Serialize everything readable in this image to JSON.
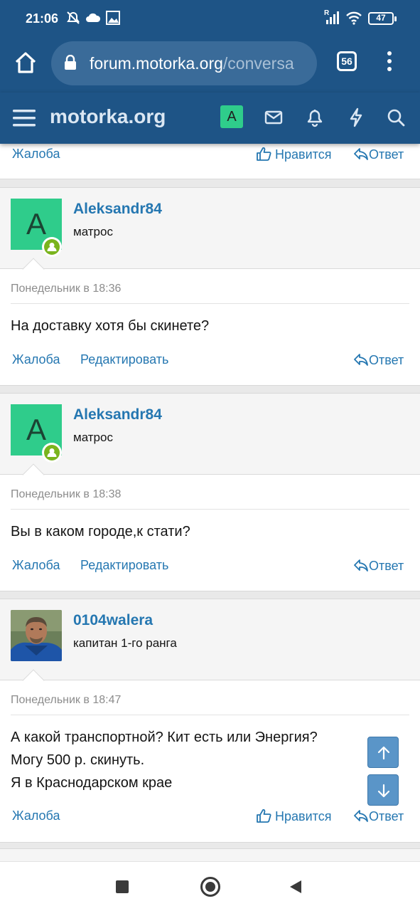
{
  "status_bar": {
    "time": "21:06",
    "signal_label": "R",
    "battery": "47",
    "icons": [
      "alarm-off-icon",
      "cloud-icon",
      "image-icon",
      "signal-icon",
      "wifi-icon",
      "battery-icon"
    ]
  },
  "browser": {
    "url_domain": "forum.motorka.org",
    "url_path": "/conversa",
    "tab_count": "56"
  },
  "site": {
    "name": "motorka.org",
    "user_initial": "A",
    "accent": "#1e5486",
    "link_color": "#2577b1"
  },
  "top_actions": {
    "report": "Жалоба",
    "like": "Нравится",
    "reply": "Ответ"
  },
  "posts": [
    {
      "username": "Aleksandr84",
      "rank": "матрос",
      "avatar_initial": "A",
      "online": true,
      "date": "Понедельник в 18:36",
      "message": [
        "На доставку хотя бы скинете?"
      ],
      "actions": {
        "report": "Жалоба",
        "edit": "Редактировать",
        "reply": "Ответ"
      }
    },
    {
      "username": "Aleksandr84",
      "rank": "матрос",
      "avatar_initial": "A",
      "online": true,
      "date": "Понедельник в 18:38",
      "message": [
        "Вы в каком городе,к стати?"
      ],
      "actions": {
        "report": "Жалоба",
        "edit": "Редактировать",
        "reply": "Ответ"
      }
    },
    {
      "username": "0104walera",
      "rank": "капитан 1-го ранга",
      "avatar_initial": "",
      "online": false,
      "date": "Понедельник в 18:47",
      "message": [
        "А какой транспортной? Кит есть или Энергия?",
        "Могу 500 р. скинуть.",
        "Я в Краснодарском крае"
      ],
      "actions": {
        "report": "Жалоба",
        "like": "Нравится",
        "reply": "Ответ"
      }
    }
  ],
  "scroll_buttons": {
    "up": "arrow-up-icon",
    "down": "arrow-down-icon"
  },
  "system_nav": [
    "recents-icon",
    "home-icon",
    "back-icon"
  ]
}
